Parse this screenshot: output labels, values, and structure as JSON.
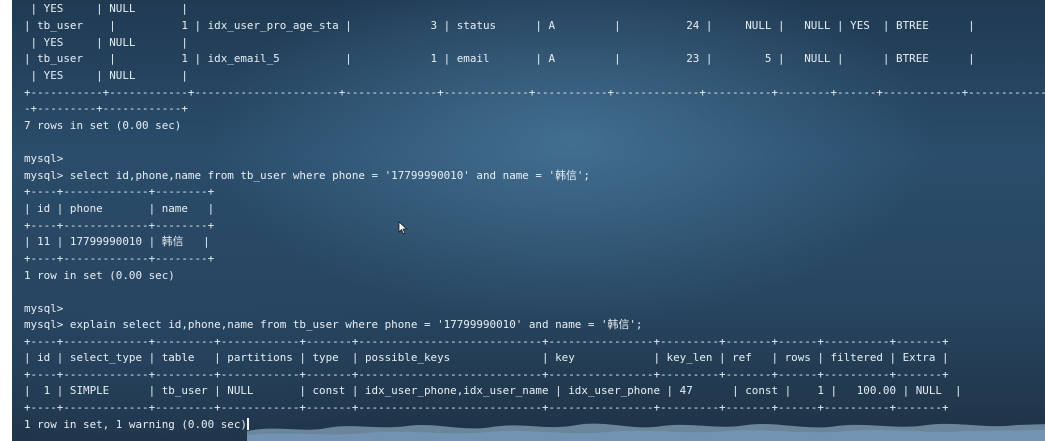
{
  "terminal": {
    "lines": [
      " | YES     | NULL       |",
      "| tb_user    |          1 | idx_user_pro_age_sta |            3 | status      | A         |          24 |     NULL |   NULL | YES  | BTREE      |",
      " | YES     | NULL       |",
      "| tb_user    |          1 | idx_email_5          |            1 | email       | A         |          23 |        5 |   NULL |      | BTREE      |",
      " | YES     | NULL       |",
      "+-----------+------------+----------------------+--------------+-------------+-----------+-------------+----------+--------+------+------------+--------------",
      "-+---------+------------+",
      "7 rows in set (0.00 sec)",
      "",
      "mysql>",
      "mysql> select id,phone,name from tb_user where phone = '17799990010' and name = '韩信';",
      "+----+-------------+--------+",
      "| id | phone       | name   |",
      "+----+-------------+--------+",
      "| 11 | 17799990010 | 韩信   |",
      "+----+-------------+--------+",
      "1 row in set (0.00 sec)",
      "",
      "mysql>",
      "mysql> explain select id,phone,name from tb_user where phone = '17799990010' and name = '韩信';",
      "+----+-------------+---------+------------+-------+----------------------------+----------------+---------+-------+------+----------+-------+",
      "| id | select_type | table   | partitions | type  | possible_keys              | key            | key_len | ref   | rows | filtered | Extra |",
      "+----+-------------+---------+------------+-------+----------------------------+----------------+---------+-------+------+----------+-------+",
      "|  1 | SIMPLE      | tb_user | NULL       | const | idx_user_phone,idx_user_name | idx_user_phone | 47      | const |    1 |   100.00 | NULL  |",
      "+----+-------------+---------+------------+-------+----------------------------+----------------+---------+-------+------+----------+-------+",
      "1 row in set, 1 warning (0.00 sec)"
    ]
  },
  "colors": {
    "text": "#e6eef5",
    "background_top": "#203a52",
    "background_mid": "#2a4d6b",
    "background_bottom": "#1f3246"
  },
  "icons": {
    "cursor": "text-cursor-icon",
    "pointer": "mouse-pointer-icon"
  }
}
